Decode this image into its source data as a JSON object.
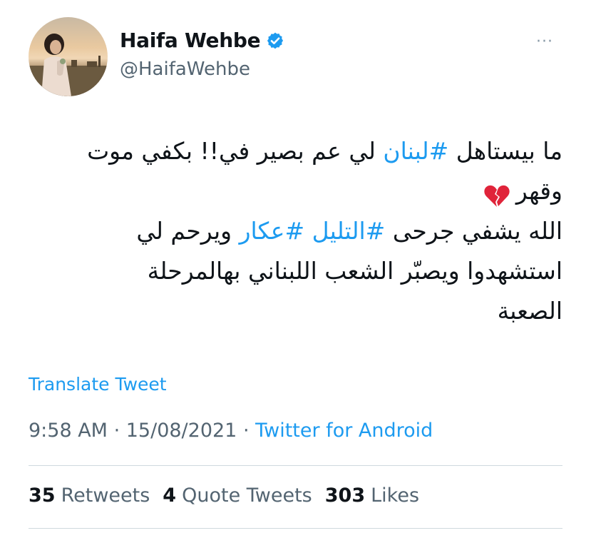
{
  "profile": {
    "display_name": "Haifa Wehbe",
    "handle": "@HaifaWehbe",
    "verified": true
  },
  "more_label": "···",
  "tweet": {
    "line1_pre": "ما بيستاهل ",
    "line1_tag": "#لبنان",
    "line1_post": " لي عم بصير في!! بكفي موت",
    "line2": "وقهر",
    "line3_pre": "الله يشفي جرحى ",
    "line3_tag1": "#التليل",
    "line3_mid": " ",
    "line3_tag2": "#عكار",
    "line3_post": " ويرحم لي",
    "line4": "استشهدوا ويصبّر الشعب اللبناني بهالمرحلة",
    "line5": "الصعبة",
    "emoji": "broken-heart-icon"
  },
  "translate_label": "Translate Tweet",
  "meta": {
    "time": "9:58 AM",
    "sep1": " · ",
    "date": "15/08/2021",
    "sep2": " · ",
    "source": "Twitter for Android"
  },
  "stats": {
    "retweets_count": "35",
    "retweets_label": "Retweets",
    "quotes_count": "4",
    "quotes_label": "Quote Tweets",
    "likes_count": "303",
    "likes_label": "Likes"
  },
  "colors": {
    "link": "#1d9bf0",
    "secondary_text": "#536471",
    "primary_text": "#0f1419",
    "divider": "#cfd9de"
  }
}
